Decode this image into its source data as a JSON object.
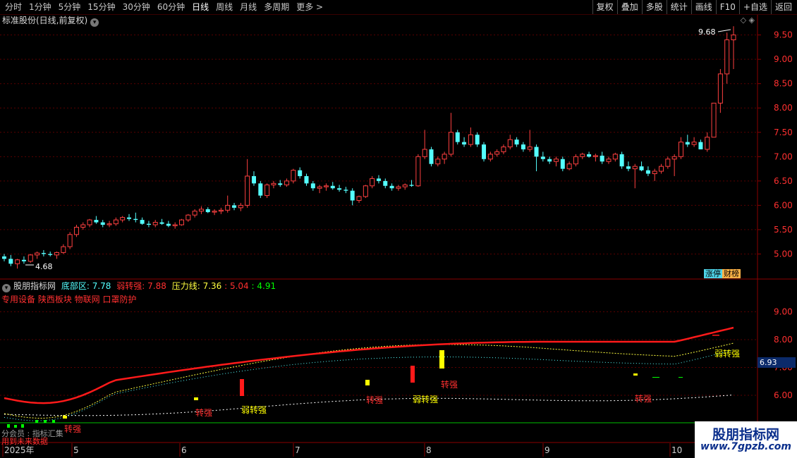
{
  "toolbar": {
    "periods": [
      "分时",
      "1分钟",
      "5分钟",
      "15分钟",
      "30分钟",
      "60分钟",
      "日线",
      "周线",
      "月线",
      "多周期",
      "更多 >"
    ],
    "active_period": "日线",
    "right_tools": [
      "复权",
      "叠加",
      "多股",
      "统计",
      "画线",
      "F10",
      "+自选",
      "返回"
    ]
  },
  "stock_title": "标准股份(日线,前复权)",
  "top_icons": "◇ ◈",
  "price_axis": [
    "9.50",
    "9.00",
    "8.50",
    "8.00",
    "7.50",
    "7.00",
    "6.50",
    "6.00",
    "5.50",
    "5.00"
  ],
  "high_label": "9.68",
  "low_label": "4.68",
  "badges": {
    "a": "涨停",
    "b": "财榜"
  },
  "indicator": {
    "name": "股朋指标网",
    "label_bottom": "底部区:",
    "value_bottom": "7.78",
    "label_weak": "弱转强:",
    "value_weak": "7.88",
    "label_pressure": "压力线:",
    "value_pressure": "7.36",
    "value_4": "5.04",
    "value_5": "4.91"
  },
  "indicator_subtitle": "专用设备 陕西板块 物联网 口罩防护",
  "lower_axis": [
    "9.00",
    "8.00",
    "7.00",
    "6.00"
  ],
  "current_price_tag": "6.93",
  "signal_labels": {
    "turn": "转强",
    "weak_turn": "弱转强"
  },
  "bottom_labels": {
    "line1": "分会员 : 指标汇集",
    "line2": "用到未来数据"
  },
  "date_axis": [
    "2025年",
    "5",
    "6",
    "7",
    "8",
    "9",
    "10"
  ],
  "watermark": {
    "cn": "股朋指标网",
    "url": "www.7gpzb.com"
  },
  "colors": {
    "up": "#ff4040",
    "down": "#54ffff",
    "red_line": "#ff1a1a",
    "yellow": "#ffff00",
    "grid": "#5a0000"
  },
  "chart_data": {
    "type": "candlestick",
    "ylim": [
      4.5,
      9.9
    ],
    "ohlc": [
      [
        4.95,
        5.0,
        4.85,
        4.9
      ],
      [
        4.9,
        4.98,
        4.75,
        4.8
      ],
      [
        4.8,
        4.9,
        4.7,
        4.88
      ],
      [
        4.88,
        4.95,
        4.8,
        4.85
      ],
      [
        4.85,
        5.0,
        4.82,
        4.98
      ],
      [
        4.98,
        5.05,
        4.9,
        5.02
      ],
      [
        5.02,
        5.08,
        4.95,
        5.0
      ],
      [
        5.0,
        5.05,
        4.95,
        4.98
      ],
      [
        4.98,
        5.05,
        4.9,
        5.03
      ],
      [
        5.03,
        5.2,
        5.0,
        5.15
      ],
      [
        5.15,
        5.45,
        5.1,
        5.4
      ],
      [
        5.4,
        5.6,
        5.35,
        5.55
      ],
      [
        5.55,
        5.65,
        5.5,
        5.6
      ],
      [
        5.6,
        5.72,
        5.55,
        5.7
      ],
      [
        5.7,
        5.78,
        5.62,
        5.65
      ],
      [
        5.65,
        5.7,
        5.55,
        5.6
      ],
      [
        5.6,
        5.68,
        5.55,
        5.62
      ],
      [
        5.62,
        5.75,
        5.58,
        5.7
      ],
      [
        5.7,
        5.78,
        5.65,
        5.75
      ],
      [
        5.75,
        5.82,
        5.68,
        5.72
      ],
      [
        5.72,
        5.85,
        5.65,
        5.7
      ],
      [
        5.7,
        5.75,
        5.6,
        5.62
      ],
      [
        5.62,
        5.68,
        5.55,
        5.6
      ],
      [
        5.6,
        5.7,
        5.55,
        5.65
      ],
      [
        5.65,
        5.72,
        5.6,
        5.62
      ],
      [
        5.62,
        5.68,
        5.55,
        5.58
      ],
      [
        5.58,
        5.65,
        5.52,
        5.6
      ],
      [
        5.6,
        5.72,
        5.58,
        5.7
      ],
      [
        5.7,
        5.82,
        5.66,
        5.8
      ],
      [
        5.8,
        5.92,
        5.75,
        5.88
      ],
      [
        5.88,
        5.98,
        5.82,
        5.92
      ],
      [
        5.92,
        5.96,
        5.84,
        5.86
      ],
      [
        5.86,
        5.92,
        5.8,
        5.88
      ],
      [
        5.88,
        5.95,
        5.82,
        5.9
      ],
      [
        5.9,
        6.2,
        5.85,
        6.0
      ],
      [
        6.0,
        6.05,
        5.9,
        5.95
      ],
      [
        5.95,
        6.05,
        5.88,
        6.0
      ],
      [
        6.0,
        6.95,
        5.95,
        6.6
      ],
      [
        6.6,
        6.7,
        6.4,
        6.45
      ],
      [
        6.45,
        6.5,
        6.15,
        6.2
      ],
      [
        6.2,
        6.45,
        6.15,
        6.42
      ],
      [
        6.42,
        6.5,
        6.35,
        6.45
      ],
      [
        6.45,
        6.52,
        6.38,
        6.42
      ],
      [
        6.42,
        6.55,
        6.38,
        6.5
      ],
      [
        6.5,
        6.75,
        6.45,
        6.72
      ],
      [
        6.72,
        6.78,
        6.55,
        6.6
      ],
      [
        6.6,
        6.65,
        6.4,
        6.45
      ],
      [
        6.45,
        6.5,
        6.3,
        6.35
      ],
      [
        6.35,
        6.42,
        6.25,
        6.38
      ],
      [
        6.38,
        6.45,
        6.3,
        6.4
      ],
      [
        6.4,
        6.48,
        6.32,
        6.35
      ],
      [
        6.35,
        6.42,
        6.28,
        6.32
      ],
      [
        6.32,
        6.38,
        6.25,
        6.3
      ],
      [
        6.3,
        6.35,
        6.0,
        6.1
      ],
      [
        6.1,
        6.2,
        6.05,
        6.18
      ],
      [
        6.18,
        6.42,
        6.15,
        6.4
      ],
      [
        6.4,
        6.6,
        6.35,
        6.55
      ],
      [
        6.55,
        6.62,
        6.45,
        6.5
      ],
      [
        6.5,
        6.55,
        6.35,
        6.4
      ],
      [
        6.4,
        6.45,
        6.3,
        6.35
      ],
      [
        6.35,
        6.42,
        6.3,
        6.38
      ],
      [
        6.38,
        6.45,
        6.32,
        6.42
      ],
      [
        6.42,
        6.52,
        6.38,
        6.4
      ],
      [
        6.4,
        7.05,
        6.38,
        7.0
      ],
      [
        7.0,
        7.55,
        6.95,
        7.15
      ],
      [
        7.15,
        7.2,
        6.8,
        6.85
      ],
      [
        6.85,
        7.0,
        6.8,
        6.95
      ],
      [
        6.95,
        7.1,
        6.85,
        7.05
      ],
      [
        7.05,
        7.9,
        7.0,
        7.5
      ],
      [
        7.5,
        7.55,
        7.25,
        7.3
      ],
      [
        7.3,
        7.4,
        7.2,
        7.25
      ],
      [
        7.25,
        7.6,
        7.2,
        7.45
      ],
      [
        7.45,
        7.5,
        7.2,
        7.25
      ],
      [
        7.25,
        7.3,
        6.9,
        6.95
      ],
      [
        6.95,
        7.1,
        6.9,
        7.05
      ],
      [
        7.05,
        7.15,
        7.0,
        7.1
      ],
      [
        7.1,
        7.25,
        7.05,
        7.2
      ],
      [
        7.2,
        7.45,
        7.15,
        7.35
      ],
      [
        7.35,
        7.4,
        7.2,
        7.25
      ],
      [
        7.25,
        7.3,
        7.1,
        7.15
      ],
      [
        7.15,
        7.55,
        7.1,
        7.2
      ],
      [
        7.2,
        7.25,
        6.7,
        7.0
      ],
      [
        7.0,
        7.1,
        6.9,
        6.95
      ],
      [
        6.95,
        7.0,
        6.85,
        6.9
      ],
      [
        6.9,
        7.0,
        6.8,
        6.95
      ],
      [
        6.95,
        7.0,
        6.7,
        6.75
      ],
      [
        6.75,
        6.9,
        6.72,
        6.85
      ],
      [
        6.85,
        7.05,
        6.8,
        7.0
      ],
      [
        7.0,
        7.08,
        6.95,
        7.05
      ],
      [
        7.05,
        7.1,
        6.98,
        7.0
      ],
      [
        7.0,
        7.06,
        6.9,
        7.02
      ],
      [
        7.02,
        7.1,
        6.85,
        6.9
      ],
      [
        6.9,
        7.0,
        6.85,
        6.95
      ],
      [
        6.95,
        7.08,
        6.9,
        7.05
      ],
      [
        7.05,
        7.1,
        6.75,
        6.8
      ],
      [
        6.8,
        6.9,
        6.7,
        6.75
      ],
      [
        6.75,
        6.85,
        6.35,
        6.8
      ],
      [
        6.8,
        6.9,
        6.7,
        6.72
      ],
      [
        6.72,
        6.8,
        6.6,
        6.65
      ],
      [
        6.65,
        6.75,
        6.5,
        6.7
      ],
      [
        6.7,
        6.85,
        6.65,
        6.8
      ],
      [
        6.8,
        7.0,
        6.75,
        6.95
      ],
      [
        6.95,
        7.05,
        6.6,
        7.0
      ],
      [
        7.0,
        7.4,
        6.95,
        7.3
      ],
      [
        7.3,
        7.45,
        7.2,
        7.25
      ],
      [
        7.25,
        7.4,
        7.2,
        7.3
      ],
      [
        7.3,
        7.35,
        7.15,
        7.15
      ],
      [
        7.15,
        7.5,
        7.1,
        7.4
      ],
      [
        7.4,
        8.1,
        7.95,
        8.1
      ],
      [
        8.1,
        8.8,
        7.9,
        8.7
      ],
      [
        8.7,
        9.55,
        8.5,
        9.4
      ],
      [
        9.4,
        9.68,
        8.8,
        9.5
      ]
    ]
  }
}
